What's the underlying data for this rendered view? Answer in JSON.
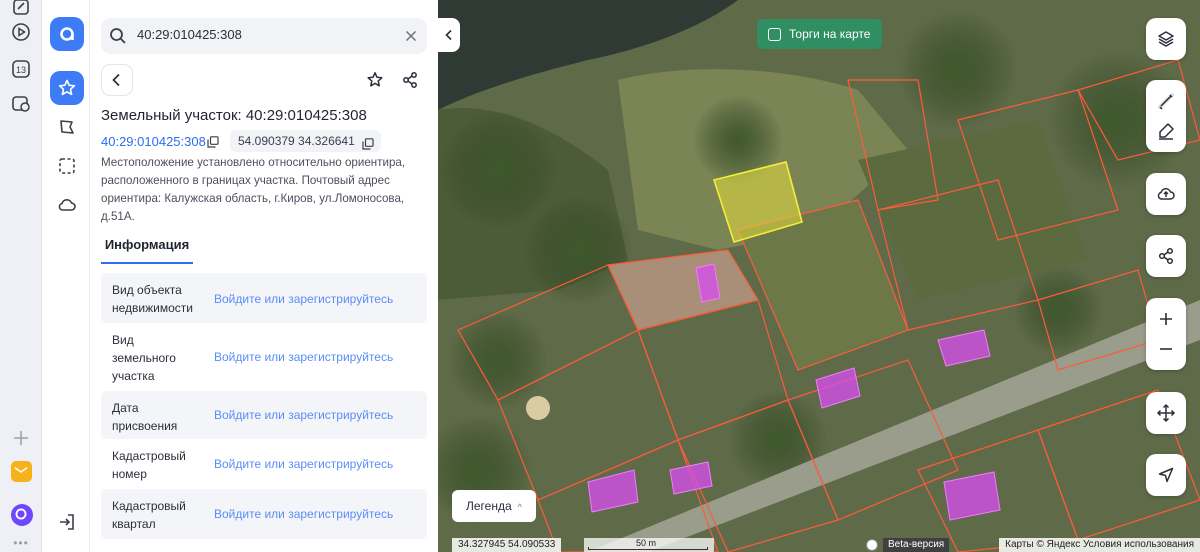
{
  "search": {
    "value": "40:29:010425:308",
    "placeholder": ""
  },
  "parcel": {
    "title": "Земельный участок: 40:29:010425:308",
    "cadastral_number": "40:29:010425:308",
    "coordinates": "54.090379 34.326641",
    "address": "Местоположение установлено относительно ориентира, расположенного в границах участка. Почтовый адрес ориентира: Калужская область, г.Киров, ул.Ломоносова, д.51А."
  },
  "tabs": [
    {
      "label": "Информация",
      "active": true
    }
  ],
  "info_rows": [
    {
      "label": "Вид объекта недвижимости",
      "value": "Войдите или зарегистрируйтесь"
    },
    {
      "label": "Вид земельного участка",
      "value": "Войдите или зарегистрируйтесь"
    },
    {
      "label": "Дата присвоения",
      "value": "Войдите или зарегистрируйтесь"
    },
    {
      "label": "Кадастровый номер",
      "value": "Войдите или зарегистрируйтесь"
    },
    {
      "label": "Кадастровый квартал",
      "value": "Войдите или зарегистрируйтесь"
    }
  ],
  "dock": {
    "calendar_day": "13"
  },
  "map": {
    "tender_toggle_label": "Торги на карте",
    "tender_toggle_checked": false,
    "legend_label": "Легенда",
    "legend_chevron": "^",
    "cursor_coordinates": "34.327945  54.090533",
    "scale_label": "50 m",
    "beta_label": "Beta-версия",
    "attribution": "Карты © Яндекс   Условия использования"
  },
  "colors": {
    "accent": "#3d7bf7",
    "link": "#2d6cf5",
    "login_link": "#5a8df6",
    "tender_toggle_bg": "#2f8f63",
    "selected_parcel_fill": "#e6e03c",
    "parcel_border": "#ff5a3c",
    "building_fill": "#d94cf0"
  },
  "icons": {
    "dock": [
      "notes-icon",
      "play-icon",
      "calendar-icon",
      "screenshot-icon",
      "plus-icon",
      "mail-icon",
      "alice-icon",
      "more-icon"
    ],
    "rail": [
      "app-logo-icon",
      "star-icon",
      "polygon-icon",
      "selection-icon",
      "cloud-icon",
      "login-icon"
    ],
    "map_controls": [
      "layers-icon",
      "ruler-icon",
      "edit-icon",
      "cloud-upload-icon",
      "share-icon",
      "zoom-in-icon",
      "zoom-out-icon",
      "move-icon",
      "locate-icon"
    ]
  }
}
